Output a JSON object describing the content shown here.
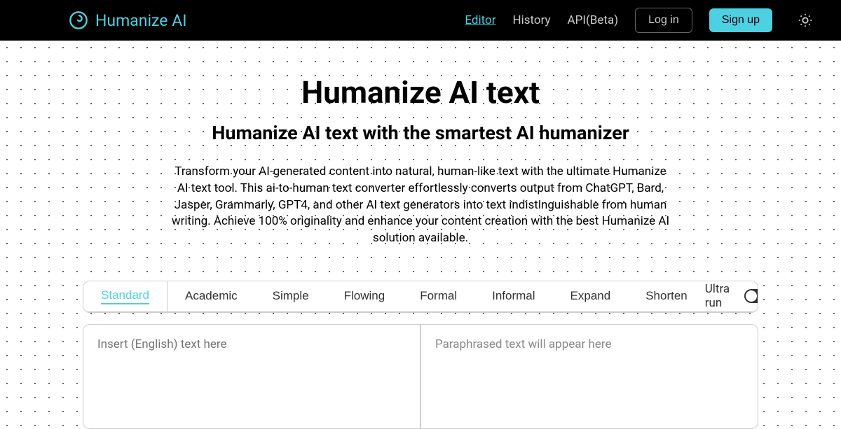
{
  "header": {
    "logo_text": "Humanize AI",
    "nav": {
      "editor": "Editor",
      "history": "History",
      "api": "API(Beta)"
    },
    "login": "Log in",
    "signup": "Sign up"
  },
  "hero": {
    "title": "Humanize AI text",
    "subtitle": "Humanize AI text with the smartest AI humanizer",
    "description": "Transform your AI-generated content into natural, human-like text with the ultimate Humanize AI text tool. This ai-to-human text converter effortlessly converts output from ChatGPT, Bard, Jasper, Grammarly, GPT4, and other AI text generators into text indistinguishable from human writing. Achieve 100% originality and enhance your content creation with the best Humanize AI solution available."
  },
  "tabs": {
    "standard": "Standard",
    "academic": "Academic",
    "simple": "Simple",
    "flowing": "Flowing",
    "formal": "Formal",
    "informal": "Informal",
    "expand": "Expand",
    "shorten": "Shorten"
  },
  "ultra_run_label": "Ultra run",
  "input_placeholder": "Insert (English) text here",
  "output_placeholder": "Paraphrased text will appear here"
}
